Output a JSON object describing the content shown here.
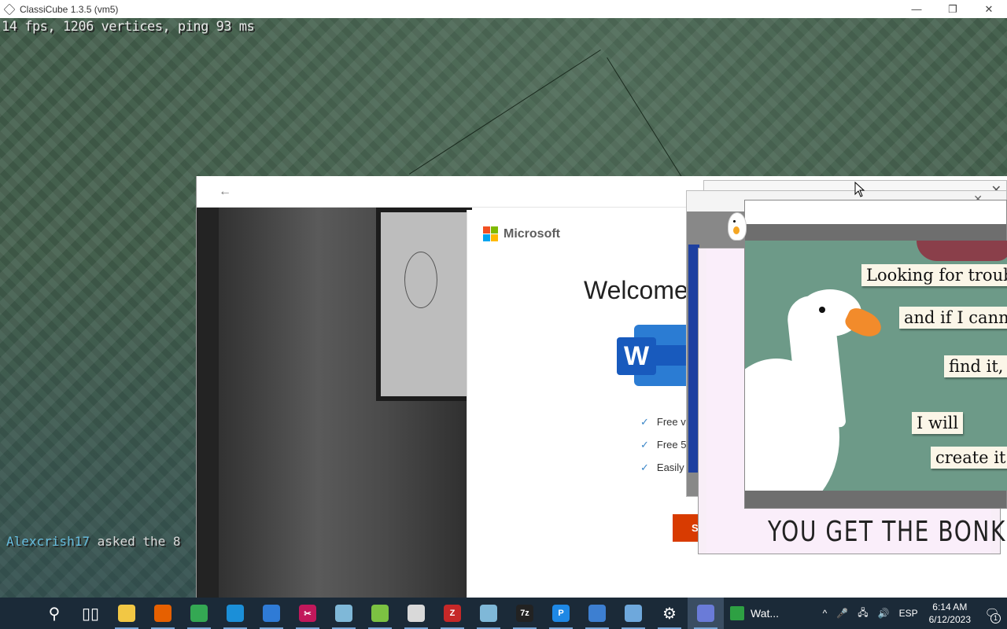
{
  "window": {
    "title": "ClassiCube 1.3.5 (vm5)",
    "minimize": "—",
    "maximize": "❐",
    "close": "✕"
  },
  "game": {
    "debug_text": "14 fps, 1206 vertices, ping 93 ms",
    "chat": {
      "name": "Alexcrish17",
      "message": " asked the 8"
    }
  },
  "office": {
    "back": "←",
    "brand": "Microsoft",
    "welcome": "Welcome",
    "word_letter": "W",
    "features": [
      "Free ve",
      "Free 5",
      "Easily s"
    ],
    "check": "✓",
    "button": "S"
  },
  "goose": {
    "close": "✕",
    "meme_lines": [
      "Looking for troub",
      "and if I canno",
      "find it,",
      "I will",
      "create it."
    ],
    "bonk": "YOU GET THE BONK"
  },
  "taskbar": {
    "watch_label": "Wat...",
    "tray": {
      "chevron": "^",
      "mic": "🎤",
      "network": "🖧",
      "volume": "🔊",
      "language": "ESP"
    },
    "time": "6:14 AM",
    "date": "6/12/2023",
    "notifications": "1",
    "icons": [
      {
        "name": "search-icon",
        "glyph": "⚲",
        "color": "#1b2a38"
      },
      {
        "name": "task-view-icon",
        "glyph": "▯▯",
        "color": "#1b2a38"
      },
      {
        "name": "file-explorer-icon",
        "glyph": "",
        "color": "#f2c744"
      },
      {
        "name": "firefox-icon",
        "glyph": "",
        "color": "#e66000"
      },
      {
        "name": "chrome-icon",
        "glyph": "",
        "color": "#34a853"
      },
      {
        "name": "edge-icon",
        "glyph": "",
        "color": "#1b8fd8"
      },
      {
        "name": "store-icon",
        "glyph": "",
        "color": "#2f7bd6"
      },
      {
        "name": "snipping-tool-icon",
        "glyph": "✂",
        "color": "#c2185b"
      },
      {
        "name": "app-cube-icon",
        "glyph": "",
        "color": "#7fb8d8"
      },
      {
        "name": "notepadpp-icon",
        "glyph": "",
        "color": "#7cc242"
      },
      {
        "name": "classicube-icon",
        "glyph": "",
        "color": "#d9d9d9"
      },
      {
        "name": "filezilla-icon",
        "glyph": "Z",
        "color": "#c62828"
      },
      {
        "name": "app-glass-icon",
        "glyph": "",
        "color": "#7fb8d8"
      },
      {
        "name": "7zip-icon",
        "glyph": "7z",
        "color": "#222222"
      },
      {
        "name": "pandora-icon",
        "glyph": "P",
        "color": "#1e88e5"
      },
      {
        "name": "remote-desktop-icon",
        "glyph": "",
        "color": "#3d7fd1"
      },
      {
        "name": "app-window-icon",
        "glyph": "",
        "color": "#6ea8dc"
      },
      {
        "name": "settings-icon",
        "glyph": "⚙",
        "color": "#1b2a38"
      },
      {
        "name": "goose-app-icon",
        "glyph": "",
        "color": "#6a7bd8"
      }
    ]
  }
}
